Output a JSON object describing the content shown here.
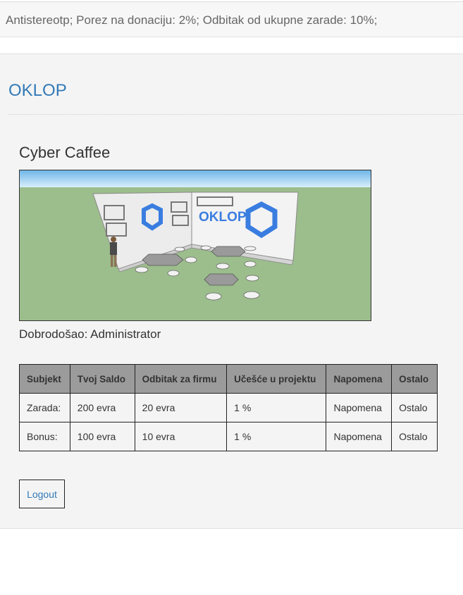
{
  "topbar": {
    "text": "Antistereotp; Porez na donaciju: 2%; Odbitak od ukupne zarade: 10%;"
  },
  "brand": "OKLOP",
  "section_title": "Cyber Caffee",
  "hero": {
    "logo_text": "OKLOP"
  },
  "welcome": "Dobrodošao: Administrator",
  "table": {
    "headers": [
      "Subjekt",
      "Tvoj Saldo",
      "Odbitak za firmu",
      "Učešće u projektu",
      "Napomena",
      "Ostalo"
    ],
    "rows": [
      [
        "Zarada:",
        "200 evra",
        "20 evra",
        "1 %",
        "Napomena",
        "Ostalo"
      ],
      [
        "Bonus:",
        "100 evra",
        "10 evra",
        "1 %",
        "Napomena",
        "Ostalo"
      ]
    ]
  },
  "logout": "Logout",
  "colors": {
    "link": "#337ab7",
    "header_bg": "#9b9b9b",
    "panel_bg": "#f4f4f4"
  }
}
